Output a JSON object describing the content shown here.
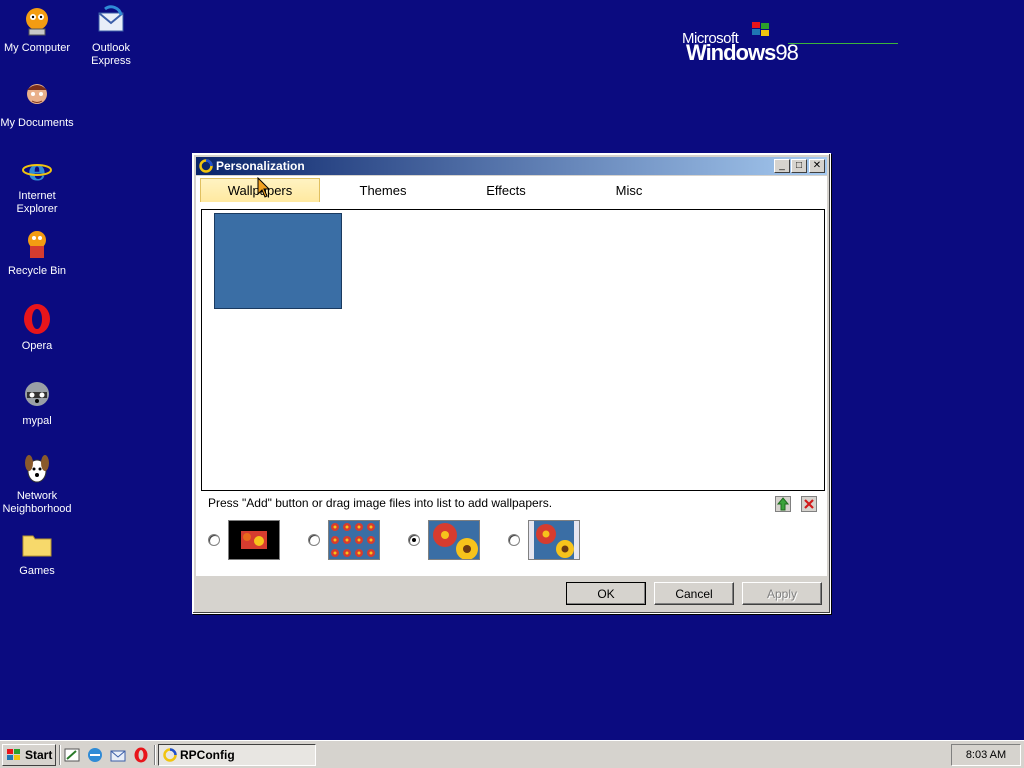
{
  "desktop": {
    "icons": [
      {
        "name": "My Computer",
        "icon": "garfield-computer-icon"
      },
      {
        "name": "Outlook Express",
        "icon": "outlook-express-icon"
      },
      {
        "name": "My Documents",
        "icon": "my-documents-icon"
      },
      {
        "name": "Internet Explorer",
        "icon": "internet-explorer-icon"
      },
      {
        "name": "Recycle Bin",
        "icon": "recycle-bin-icon"
      },
      {
        "name": "Opera",
        "icon": "opera-icon"
      },
      {
        "name": "mypal",
        "icon": "mypal-raccoon-icon"
      },
      {
        "name": "Network Neighborhood",
        "icon": "network-neighborhood-icon"
      },
      {
        "name": "Games",
        "icon": "folder-icon"
      }
    ],
    "logo": {
      "microsoft": "Microsoft",
      "windows": "Windows",
      "version": "98"
    }
  },
  "dialog": {
    "title": "Personalization",
    "tabs": [
      "Wallpapers",
      "Themes",
      "Effects",
      "Misc"
    ],
    "active_tab": "Wallpapers",
    "wallpaper_color": "#3a6ea5",
    "hint": "Press \"Add\" button or drag image files into list to add wallpapers.",
    "style_options": [
      {
        "style": "center",
        "selected": false
      },
      {
        "style": "tile",
        "selected": false
      },
      {
        "style": "stretch",
        "selected": true
      },
      {
        "style": "fit",
        "selected": false
      }
    ],
    "buttons": {
      "ok": "OK",
      "cancel": "Cancel",
      "apply": "Apply"
    }
  },
  "taskbar": {
    "start_label": "Start",
    "task": "RPConfig",
    "clock": "8:03 AM"
  }
}
